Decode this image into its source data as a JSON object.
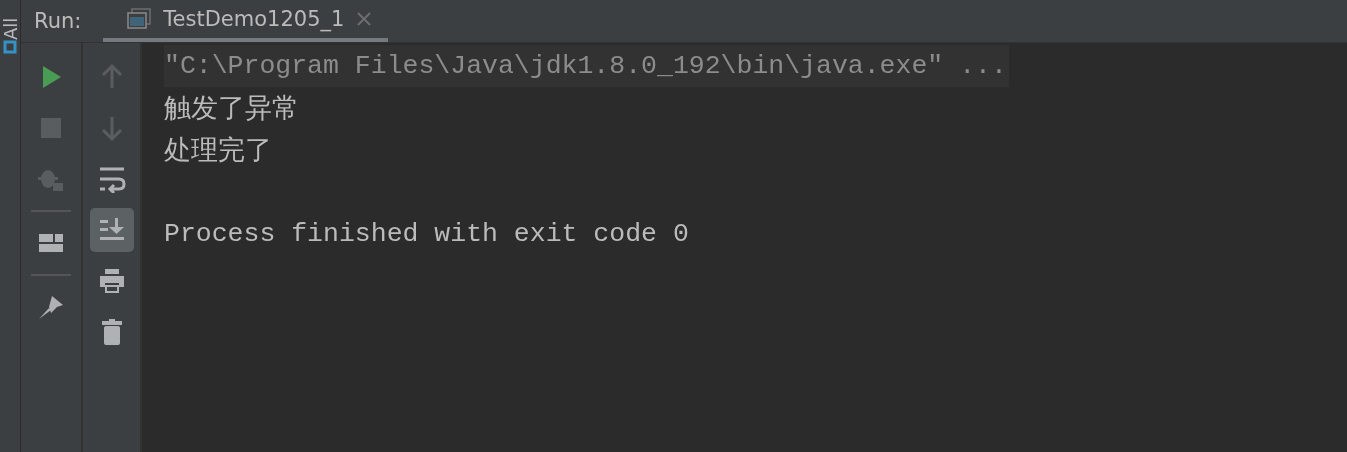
{
  "side_strip": {
    "label": "All"
  },
  "run_panel": {
    "label": "Run:",
    "tabs": [
      {
        "title": "TestDemo1205_1",
        "selected": true
      }
    ]
  },
  "left_toolbar": [
    {
      "kind": "rerun",
      "disabled": false
    },
    {
      "kind": "stop",
      "disabled": true
    },
    {
      "kind": "debug",
      "disabled": true
    },
    {
      "kind": "separator"
    },
    {
      "kind": "layout",
      "disabled": false
    },
    {
      "kind": "separator"
    },
    {
      "kind": "pin",
      "disabled": false
    }
  ],
  "right_toolbar": [
    {
      "kind": "up",
      "disabled": true,
      "on": false
    },
    {
      "kind": "down",
      "disabled": true,
      "on": false
    },
    {
      "kind": "wrap",
      "disabled": false,
      "on": false
    },
    {
      "kind": "scroll-end",
      "disabled": false,
      "on": true
    },
    {
      "kind": "print",
      "disabled": false,
      "on": false
    },
    {
      "kind": "trash",
      "disabled": false,
      "on": false
    }
  ],
  "console": {
    "lines": [
      {
        "text": "\"C:\\Program Files\\Java\\jdk1.8.0_192\\bin\\java.exe\" ...",
        "kind": "command"
      },
      {
        "text": "触发了异常",
        "kind": "output"
      },
      {
        "text": "处理完了",
        "kind": "output"
      },
      {
        "kind": "blank"
      },
      {
        "text": "Process finished with exit code 0",
        "kind": "output"
      }
    ]
  }
}
